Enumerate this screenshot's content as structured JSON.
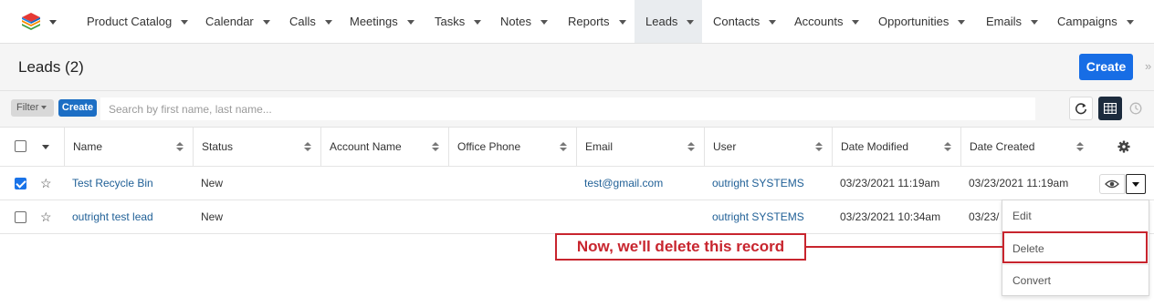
{
  "nav": {
    "logo_icon": "layers-logo-icon",
    "items": [
      {
        "label": "Product Catalog"
      },
      {
        "label": "Calendar"
      },
      {
        "label": "Calls"
      },
      {
        "label": "Meetings"
      },
      {
        "label": "Tasks"
      },
      {
        "label": "Notes"
      },
      {
        "label": "Reports"
      },
      {
        "label": "Leads",
        "active": true
      },
      {
        "label": "Contacts"
      },
      {
        "label": "Accounts"
      },
      {
        "label": "Opportunities"
      },
      {
        "label": "Emails"
      },
      {
        "label": "Campaigns"
      }
    ]
  },
  "header": {
    "title": "Leads (2)",
    "create_label": "Create"
  },
  "filterbar": {
    "filter_label": "Filter",
    "create_label": "Create",
    "search_placeholder": "Search by first name, last name..."
  },
  "table": {
    "columns": [
      "Name",
      "Status",
      "Account Name",
      "Office Phone",
      "Email",
      "User",
      "Date Modified",
      "Date Created"
    ],
    "rows": [
      {
        "checked": true,
        "name": "Test Recycle Bin",
        "status": "New",
        "account_name": "",
        "office_phone": "",
        "email": "test@gmail.com",
        "user": "outright SYSTEMS",
        "date_modified": "03/23/2021 11:19am",
        "date_created": "03/23/2021 11:19am"
      },
      {
        "checked": false,
        "name": "outright test lead",
        "status": "New",
        "account_name": "",
        "office_phone": "",
        "email": "",
        "user": "outright SYSTEMS",
        "date_modified": "03/23/2021 10:34am",
        "date_created": "03/23/"
      }
    ]
  },
  "row_actions": {
    "items": [
      "Edit",
      "Delete",
      "Convert"
    ],
    "highlighted": "Delete"
  },
  "annotation": {
    "text": "Now, we'll delete this record",
    "color": "#c8252e"
  },
  "colors": {
    "primary_button": "#176de5",
    "link": "#1f5f96",
    "active_nav": "#e9ecef",
    "grid_button": "#1c2b3d"
  }
}
